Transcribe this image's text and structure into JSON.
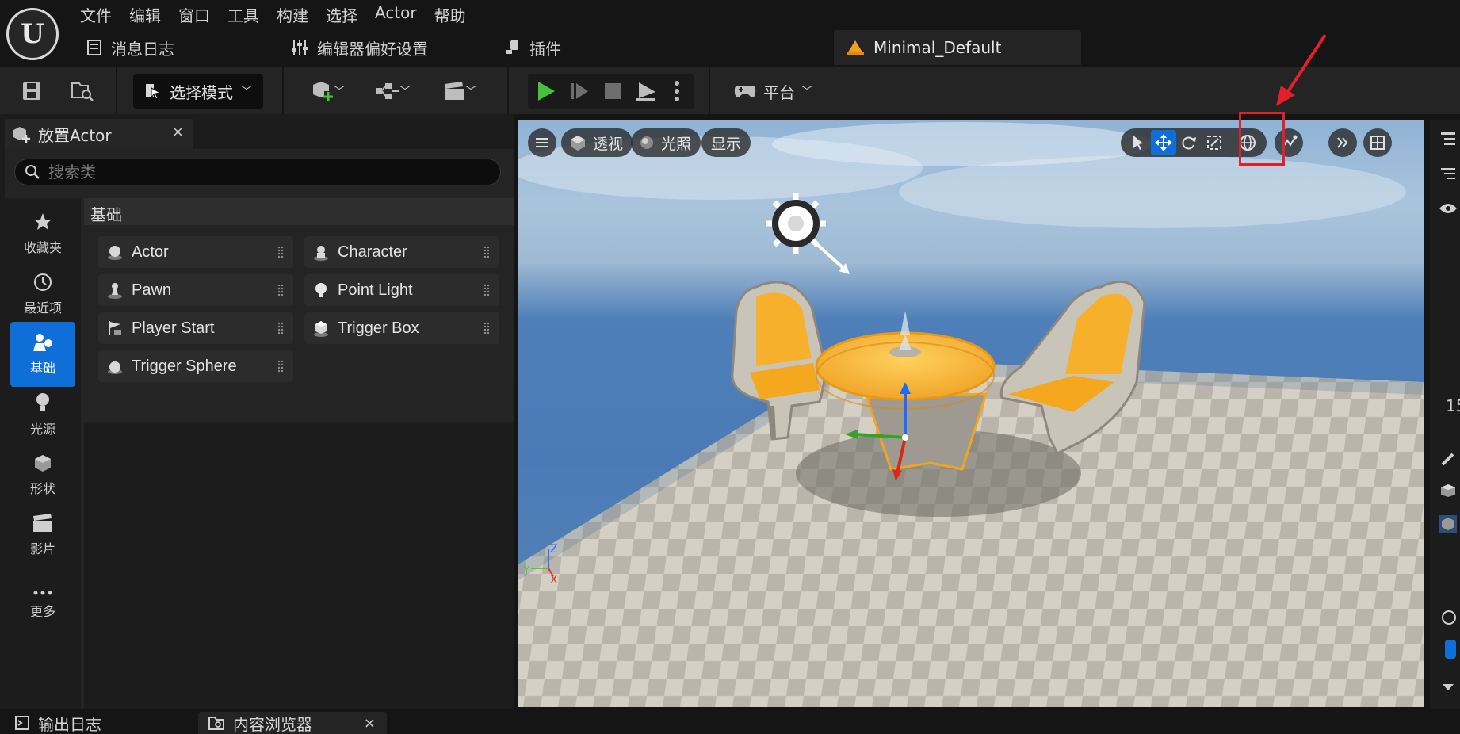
{
  "app": {
    "menu": [
      "文件",
      "编辑",
      "窗口",
      "工具",
      "构建",
      "选择",
      "Actor",
      "帮助"
    ],
    "tabs": {
      "message_log": "消息日志",
      "editor_prefs": "编辑器偏好设置",
      "plugins": "插件",
      "level": "Minimal_Default"
    }
  },
  "toolbar": {
    "mode_label": "选择模式",
    "platform_label": "平台"
  },
  "place_panel": {
    "title": "放置Actor",
    "close": "×",
    "search_placeholder": "搜索类",
    "categories": [
      "收藏夹",
      "最近项",
      "基础",
      "光源",
      "形状",
      "影片",
      "更多"
    ],
    "active_category": "基础",
    "section_title": "基础",
    "items": [
      "Actor",
      "Character",
      "Pawn",
      "Point Light",
      "Player Start",
      "Trigger Box",
      "Trigger Sphere"
    ]
  },
  "viewport": {
    "perspective_label": "透视",
    "lighting_label": "光照",
    "show_label": "显示",
    "axis_labels": [
      "Z",
      "Y",
      "X"
    ]
  },
  "right_edge": {
    "partial_number": "15"
  },
  "bottom": {
    "output_log": "输出日志",
    "content_browser": "内容浏览器",
    "close": "×"
  },
  "colors": {
    "accent": "#0f6fd8",
    "play_green": "#46c23a",
    "highlight_red": "#e3202a",
    "chair_orange": "#f7b02c"
  }
}
